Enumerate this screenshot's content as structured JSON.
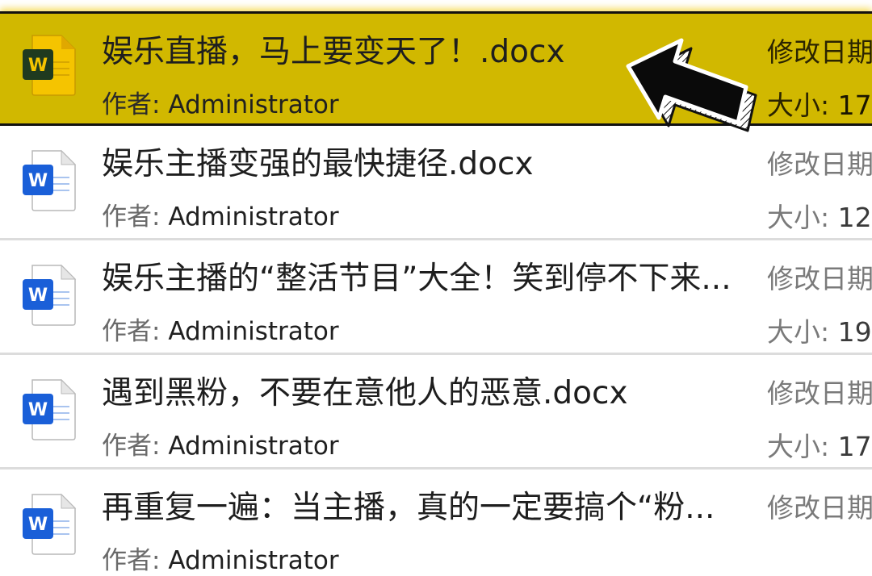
{
  "files": [
    {
      "name": "娱乐直播，马上要变天了！.docx",
      "author_label": "作者:",
      "author": "Administrator",
      "date_label": "修改日期",
      "size_label": "大小:",
      "size": "17.",
      "selected": true
    },
    {
      "name": "娱乐主播变强的最快捷径.docx",
      "author_label": "作者:",
      "author": "Administrator",
      "date_label": "修改日期",
      "size_label": "大小:",
      "size": "12.",
      "selected": false
    },
    {
      "name": "娱乐主播的“整活节目”大全！笑到停不下来...",
      "author_label": "作者:",
      "author": "Administrator",
      "date_label": "修改日期",
      "size_label": "大小:",
      "size": "19.",
      "selected": false
    },
    {
      "name": "遇到黑粉，不要在意他人的恶意.docx",
      "author_label": "作者:",
      "author": "Administrator",
      "date_label": "修改日期",
      "size_label": "大小:",
      "size": "17.",
      "selected": false
    },
    {
      "name": "再重复一遍：当主播，真的一定要搞个“粉...",
      "author_label": "作者:",
      "author": "Administrator",
      "date_label": "修改日期",
      "size_label": "大小:",
      "size": "",
      "selected": false
    }
  ],
  "icons": {
    "file_icon": "word-doc-icon",
    "pointer": "arrow-pointer-icon"
  },
  "colors": {
    "highlight": "#d1b800",
    "word_blue": "#1a5fd8",
    "word_dark": "#1f3a1f",
    "word_yellow": "#f5c400"
  }
}
